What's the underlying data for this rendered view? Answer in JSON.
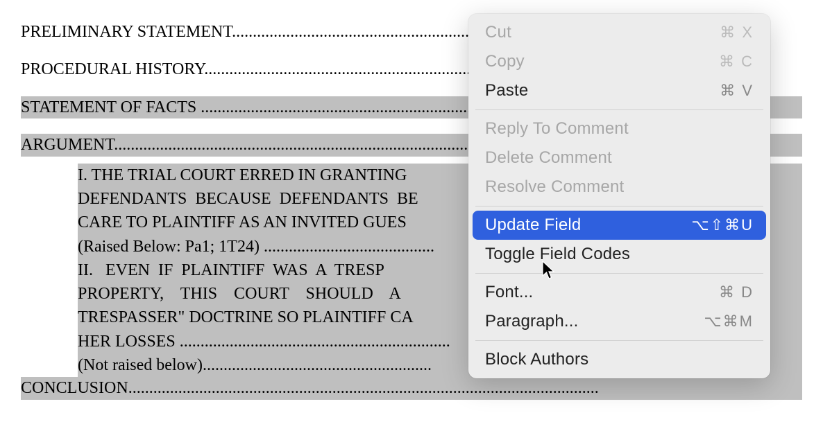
{
  "document": {
    "toc": [
      {
        "label": "PRELIMINARY STATEMENT",
        "dots": "..............................................................................................",
        "selected": false
      },
      {
        "label": "PROCEDURAL HISTORY",
        "dots": "..................................................................................................",
        "selected": false
      },
      {
        "label": "STATEMENT OF FACTS ",
        "dots": "...................................................................................................",
        "selected": true
      },
      {
        "label": "ARGUMENT",
        "dots": ".........................................................................................................................",
        "selected": true
      }
    ],
    "argument": {
      "line1": "I. THE TRIAL COURT ERRED IN GRANTING",
      "line2": "DEFENDANTS  BECAUSE  DEFENDANTS  BE",
      "line3": "CARE TO PLAINTIFF AS AN INVITED GUES",
      "line4": "(Raised Below: Pa1; 1T24) .........................................",
      "line5": "II.   EVEN  IF  PLAINTIFF  WAS  A  TRESP",
      "line6": "PROPERTY,    THIS    COURT    SHOULD    A",
      "line7": "TRESPASSER\" DOCTRINE SO PLAINTIFF CA",
      "line8": "HER LOSSES .................................................................",
      "line9": "(Not raised below)......................................................."
    },
    "conclusion": {
      "label": "CONCLUSION",
      "dots": "................................................................................................................."
    }
  },
  "menu": {
    "cut": {
      "label": "Cut",
      "shortcut": "⌘ X"
    },
    "copy": {
      "label": "Copy",
      "shortcut": "⌘ C"
    },
    "paste": {
      "label": "Paste",
      "shortcut": "⌘ V"
    },
    "reply": {
      "label": "Reply To Comment"
    },
    "deletec": {
      "label": "Delete Comment"
    },
    "resolve": {
      "label": "Resolve Comment"
    },
    "update": {
      "label": "Update Field",
      "shortcut": "⌥⇧⌘U"
    },
    "toggle": {
      "label": "Toggle Field Codes"
    },
    "font": {
      "label": "Font...",
      "shortcut": "⌘ D"
    },
    "paragraph": {
      "label": "Paragraph...",
      "shortcut": "⌥⌘M"
    },
    "block": {
      "label": "Block Authors"
    }
  }
}
